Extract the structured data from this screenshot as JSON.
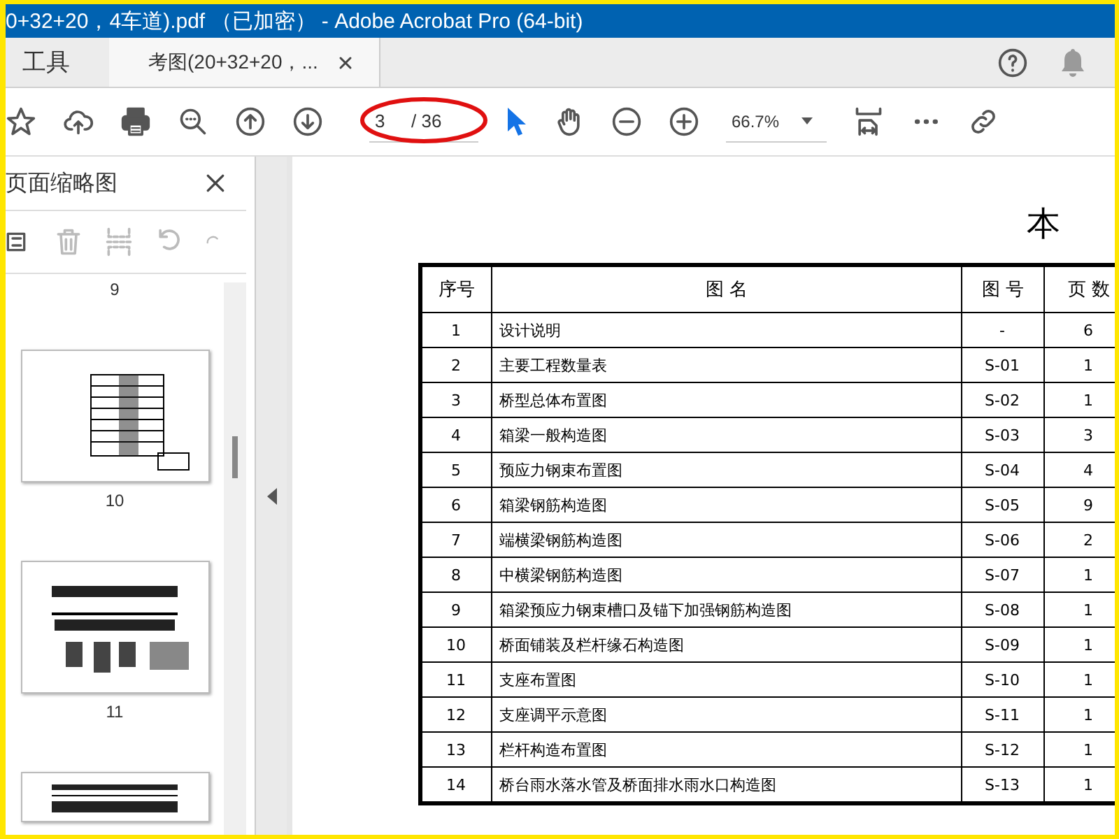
{
  "window": {
    "title": "0+32+20，4车道).pdf （已加密） - Adobe Acrobat Pro (64-bit)"
  },
  "tabs": [
    {
      "label": "工具",
      "selected": false
    },
    {
      "label": "考图(20+32+20，...",
      "selected": true
    }
  ],
  "toolbar": {
    "page_current": "3",
    "page_total": "/ 36",
    "zoom": "66.7%"
  },
  "sidebar": {
    "title": "页面缩略图",
    "thumbnails": [
      {
        "label": "9",
        "kind": "cut"
      },
      {
        "label": "10",
        "kind": "table"
      },
      {
        "label": "11",
        "kind": "drawing"
      },
      {
        "kind": "partial"
      }
    ]
  },
  "document": {
    "title": "本",
    "table": {
      "columns": [
        "序号",
        "图 名",
        "图 号",
        "页 数"
      ],
      "rows": [
        [
          "1",
          "设计说明",
          "-",
          "6"
        ],
        [
          "2",
          "主要工程数量表",
          "S-01",
          "1"
        ],
        [
          "3",
          "桥型总体布置图",
          "S-02",
          "1"
        ],
        [
          "4",
          "箱梁一般构造图",
          "S-03",
          "3"
        ],
        [
          "5",
          "预应力钢束布置图",
          "S-04",
          "4"
        ],
        [
          "6",
          "箱梁钢筋构造图",
          "S-05",
          "9"
        ],
        [
          "7",
          "端横梁钢筋构造图",
          "S-06",
          "2"
        ],
        [
          "8",
          "中横梁钢筋构造图",
          "S-07",
          "1"
        ],
        [
          "9",
          "箱梁预应力钢束槽口及锚下加强钢筋构造图",
          "S-08",
          "1"
        ],
        [
          "10",
          "桥面铺装及栏杆缘石构造图",
          "S-09",
          "1"
        ],
        [
          "11",
          "支座布置图",
          "S-10",
          "1"
        ],
        [
          "12",
          "支座调平示意图",
          "S-11",
          "1"
        ],
        [
          "13",
          "栏杆构造布置图",
          "S-12",
          "1"
        ],
        [
          "14",
          "桥台雨水落水管及桥面排水雨水口构造图",
          "S-13",
          "1"
        ]
      ]
    }
  }
}
